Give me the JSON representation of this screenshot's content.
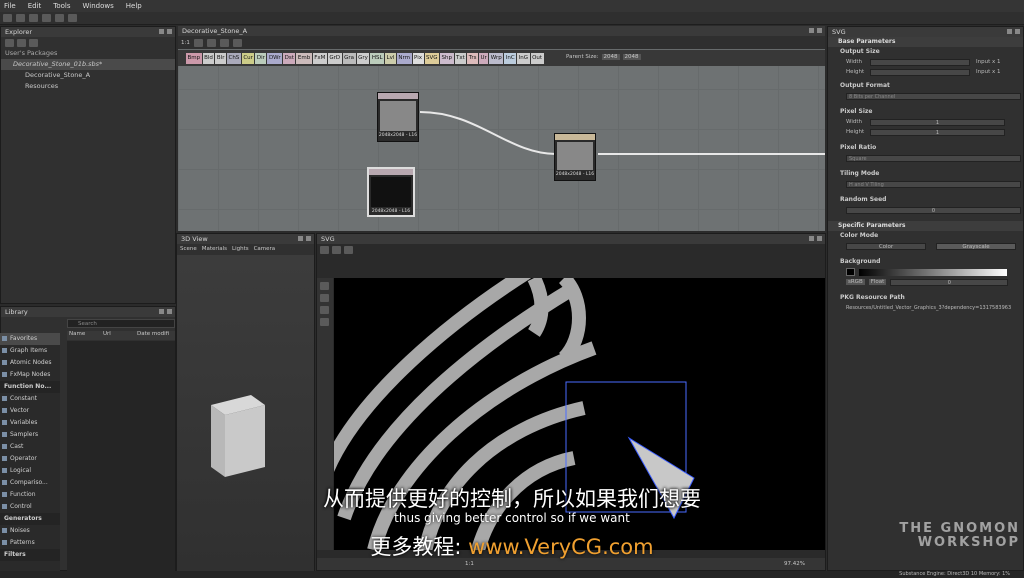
{
  "menu": [
    "File",
    "Edit",
    "Tools",
    "Windows",
    "Help"
  ],
  "explorer": {
    "title": "Explorer",
    "section": "User's Packages",
    "items": [
      "Decorative_Stone_01b.sbs*",
      "Decorative_Stone_A",
      "Resources"
    ]
  },
  "graph": {
    "title": "Decorative_Stone_A",
    "zoom": "1:1",
    "tabs": [
      "Bmp",
      "Bld",
      "Blr",
      "ChS",
      "Cur",
      "Dir",
      "DWr",
      "Dst",
      "Emb",
      "FxM",
      "GrD",
      "Gra",
      "Gry",
      "HSL",
      "Lvl",
      "Nrm",
      "Pix",
      "SVG",
      "Shp",
      "Txt",
      "Trs",
      "Ur",
      "Wrp",
      "InC",
      "InG",
      "Out"
    ],
    "parent_size_label": "Parent Size:",
    "size_a": "2048",
    "size_b": "2048",
    "nodes": [
      {
        "label": "2048x2048 - L16"
      },
      {
        "label": "2048x2048 - L16"
      },
      {
        "label": "2048x2048 - L16"
      }
    ]
  },
  "view3d": {
    "title": "3D View",
    "menu": [
      "Scene",
      "Materials",
      "Lights",
      "Camera"
    ]
  },
  "library": {
    "title": "Library",
    "search_placeholder": "Search",
    "columns": [
      "Name",
      "Url",
      "Date modifi"
    ],
    "items": [
      {
        "t": "Favorites",
        "h": false
      },
      {
        "t": "Graph Items",
        "h": false
      },
      {
        "t": "Atomic Nodes",
        "h": false
      },
      {
        "t": "FxMap Nodes",
        "h": false
      },
      {
        "t": "Function No...",
        "h": true
      },
      {
        "t": "Constant",
        "h": false
      },
      {
        "t": "Vector",
        "h": false
      },
      {
        "t": "Variables",
        "h": false
      },
      {
        "t": "Samplers",
        "h": false
      },
      {
        "t": "Cast",
        "h": false
      },
      {
        "t": "Operator",
        "h": false
      },
      {
        "t": "Logical",
        "h": false
      },
      {
        "t": "Compariso...",
        "h": false
      },
      {
        "t": "Function",
        "h": false
      },
      {
        "t": "Control",
        "h": false
      },
      {
        "t": "Generators",
        "h": true
      },
      {
        "t": "Noises",
        "h": false
      },
      {
        "t": "Patterns",
        "h": false
      },
      {
        "t": "Filters",
        "h": true
      }
    ]
  },
  "svg_view": {
    "title": "SVG",
    "zoom": "97.42%",
    "ratio": "1:1"
  },
  "properties": {
    "title": "SVG",
    "base_header": "Base Parameters",
    "output_size": "Output Size",
    "width_label": "Width",
    "height_label": "Height",
    "width_rel": "Input x 1",
    "height_rel": "Input x 1",
    "output_format": "Output Format",
    "output_format_val": "8 Bits per Channel",
    "pixel_size": "Pixel Size",
    "px_w": "1",
    "px_h": "1",
    "pixel_ratio": "Pixel Ratio",
    "pixel_ratio_val": "Square",
    "tiling_mode": "Tiling Mode",
    "tiling_val": "H and V Tiling",
    "random_seed": "Random Seed",
    "seed_val": "0",
    "specific_header": "Specific Parameters",
    "color_mode": "Color Mode",
    "color_btn": "Color",
    "gray_btn": "Grayscale",
    "background": "Background",
    "srgb": "sRGB",
    "float": "Float",
    "bg_val": "0",
    "pkg_path_label": "PKG Resource Path",
    "pkg_path": "Resources/Untitled_Vector_Graphics_3?dependency=1317583963"
  },
  "status": "Substance Engine: Direct3D 10  Memory: 1%",
  "subtitles": {
    "cn": "从而提供更好的控制，所以如果我们想要",
    "en": "thus giving better control so if we want",
    "promo_cn": "更多教程:",
    "promo_url": "www.VeryCG.com"
  },
  "watermark": "THE GNOMON WORKSHOP",
  "colors": {
    "accent": "#f0a030",
    "graph_bg": "#6e7273"
  }
}
